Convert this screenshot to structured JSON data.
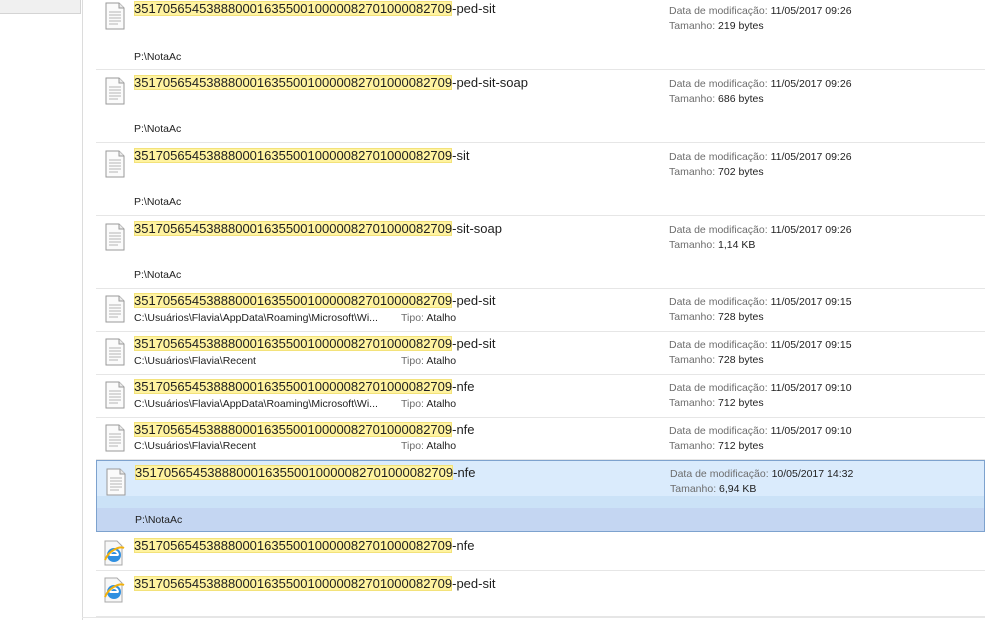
{
  "labels": {
    "modified": "Data de modificação:",
    "size": "Tamanho:",
    "type": "Tipo:"
  },
  "items": [
    {
      "prefix": "35170565453888000163550010000082701000082709",
      "suffix": "-ped-sit",
      "path": "P:\\NotaAc",
      "modified": "11/05/2017 09:26",
      "size": "219 bytes"
    },
    {
      "prefix": "35170565453888000163550010000082701000082709",
      "suffix": "-ped-sit-soap",
      "path": "P:\\NotaAc",
      "modified": "11/05/2017 09:26",
      "size": "686 bytes"
    },
    {
      "prefix": "35170565453888000163550010000082701000082709",
      "suffix": "-sit",
      "path": "P:\\NotaAc",
      "modified": "11/05/2017 09:26",
      "size": "702 bytes"
    },
    {
      "prefix": "35170565453888000163550010000082701000082709",
      "suffix": "-sit-soap",
      "path": "P:\\NotaAc",
      "modified": "11/05/2017 09:26",
      "size": "1,14 KB"
    },
    {
      "prefix": "35170565453888000163550010000082701000082709",
      "suffix": "-ped-sit",
      "path": "C:\\Usuários\\Flavia\\AppData\\Roaming\\Microsoft\\Wi...",
      "type": "Atalho",
      "modified": "11/05/2017 09:15",
      "size": "728 bytes"
    },
    {
      "prefix": "35170565453888000163550010000082701000082709",
      "suffix": "-ped-sit",
      "path": "C:\\Usuários\\Flavia\\Recent",
      "type": "Atalho",
      "modified": "11/05/2017 09:15",
      "size": "728 bytes"
    },
    {
      "prefix": "35170565453888000163550010000082701000082709",
      "suffix": "-nfe",
      "path": "C:\\Usuários\\Flavia\\AppData\\Roaming\\Microsoft\\Wi...",
      "type": "Atalho",
      "modified": "11/05/2017 09:10",
      "size": "712 bytes"
    },
    {
      "prefix": "35170565453888000163550010000082701000082709",
      "suffix": "-nfe",
      "path": "C:\\Usuários\\Flavia\\Recent",
      "type": "Atalho",
      "modified": "11/05/2017 09:10",
      "size": "712 bytes"
    },
    {
      "prefix": "35170565453888000163550010000082701000082709",
      "suffix": "-nfe",
      "path": "P:\\NotaAc",
      "modified": "10/05/2017 14:32",
      "size": "6,94 KB",
      "selected": true
    },
    {
      "prefix": "35170565453888000163550010000082701000082709",
      "suffix": "-nfe",
      "icon": "ie-icon"
    },
    {
      "prefix": "35170565453888000163550010000082701000082709",
      "suffix": "-ped-sit",
      "icon": "ie-icon"
    }
  ],
  "colors": {
    "highlight": "#fff3a0",
    "selection": "#daebfc",
    "selection_border": "#7da2ce"
  }
}
